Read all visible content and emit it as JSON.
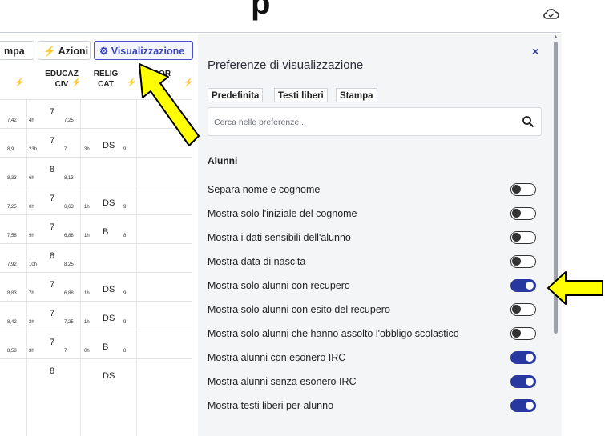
{
  "header": {
    "cut_title": "p"
  },
  "toolbar": {
    "print_label": "mpa",
    "actions_label": "Azioni",
    "view_label": "Visualizzazione"
  },
  "columns": [
    {
      "label": "EDUCAZ\nCIV",
      "bolt": "⚡"
    },
    {
      "label": "RELIG\nCAT",
      "bolt": "⚡"
    },
    {
      "label": "CAPOR\nTA",
      "bolt": "⚡"
    }
  ],
  "first_bolt": "⚡",
  "rows": [
    {
      "prev_avg": "7,42",
      "hours": "4h",
      "grade": "7",
      "avg": "7,25",
      "rel_hours": "",
      "rel_grade": "",
      "rel_avg": ""
    },
    {
      "prev_avg": "8,9",
      "hours": "23h",
      "grade": "7",
      "avg": "7",
      "rel_hours": "3h",
      "rel_grade": "DS",
      "rel_avg": "9"
    },
    {
      "prev_avg": "8,33",
      "hours": "6h",
      "grade": "8",
      "avg": "8,13",
      "rel_hours": "",
      "rel_grade": "",
      "rel_avg": ""
    },
    {
      "prev_avg": "7,25",
      "hours": "0h",
      "grade": "7",
      "avg": "6,63",
      "rel_hours": "1h",
      "rel_grade": "DS",
      "rel_avg": "9"
    },
    {
      "prev_avg": "7,58",
      "hours": "9h",
      "grade": "7",
      "avg": "6,88",
      "rel_hours": "1h",
      "rel_grade": "B",
      "rel_avg": "8"
    },
    {
      "prev_avg": "7,92",
      "hours": "10h",
      "grade": "8",
      "avg": "8,25",
      "rel_hours": "",
      "rel_grade": "",
      "rel_avg": ""
    },
    {
      "prev_avg": "8,83",
      "hours": "7h",
      "grade": "7",
      "avg": "6,88",
      "rel_hours": "1h",
      "rel_grade": "DS",
      "rel_avg": "9"
    },
    {
      "prev_avg": "8,42",
      "hours": "3h",
      "grade": "7",
      "avg": "7,25",
      "rel_hours": "1h",
      "rel_grade": "DS",
      "rel_avg": "9"
    },
    {
      "prev_avg": "8,58",
      "hours": "3h",
      "grade": "7",
      "avg": "7",
      "rel_hours": "0h",
      "rel_grade": "B",
      "rel_avg": "8"
    },
    {
      "prev_avg": "",
      "hours": "",
      "grade": "8",
      "avg": "",
      "rel_hours": "",
      "rel_grade": "DS",
      "rel_avg": ""
    }
  ],
  "panel": {
    "title": "Preferenze di visualizzazione",
    "close": "×",
    "presets": [
      "Predefinita",
      "Testi liberi",
      "Stampa"
    ],
    "search_placeholder": "Cerca nelle preferenze...",
    "section": "Alunni",
    "preferences": [
      {
        "label": "Separa nome e cognome",
        "enabled": false
      },
      {
        "label": "Mostra solo l'iniziale del cognome",
        "enabled": false
      },
      {
        "label": "Mostra i dati sensibili dell'alunno",
        "enabled": false
      },
      {
        "label": "Mostra data di nascita",
        "enabled": false
      },
      {
        "label": "Mostra solo alunni con recupero",
        "enabled": true
      },
      {
        "label": "Mostra solo alunni con esito del recupero",
        "enabled": false
      },
      {
        "label": "Mostra solo alunni che hanno assolto l'obbligo scolastico",
        "enabled": false
      },
      {
        "label": "Mostra alunni con esonero IRC",
        "enabled": true
      },
      {
        "label": "Mostra alunni senza esonero IRC",
        "enabled": true
      },
      {
        "label": "Mostra testi liberi per alunno",
        "enabled": true
      }
    ]
  },
  "colors": {
    "accent": "#2738a0",
    "arrow_fill": "#ffff00",
    "arrow_stroke": "#000000"
  }
}
